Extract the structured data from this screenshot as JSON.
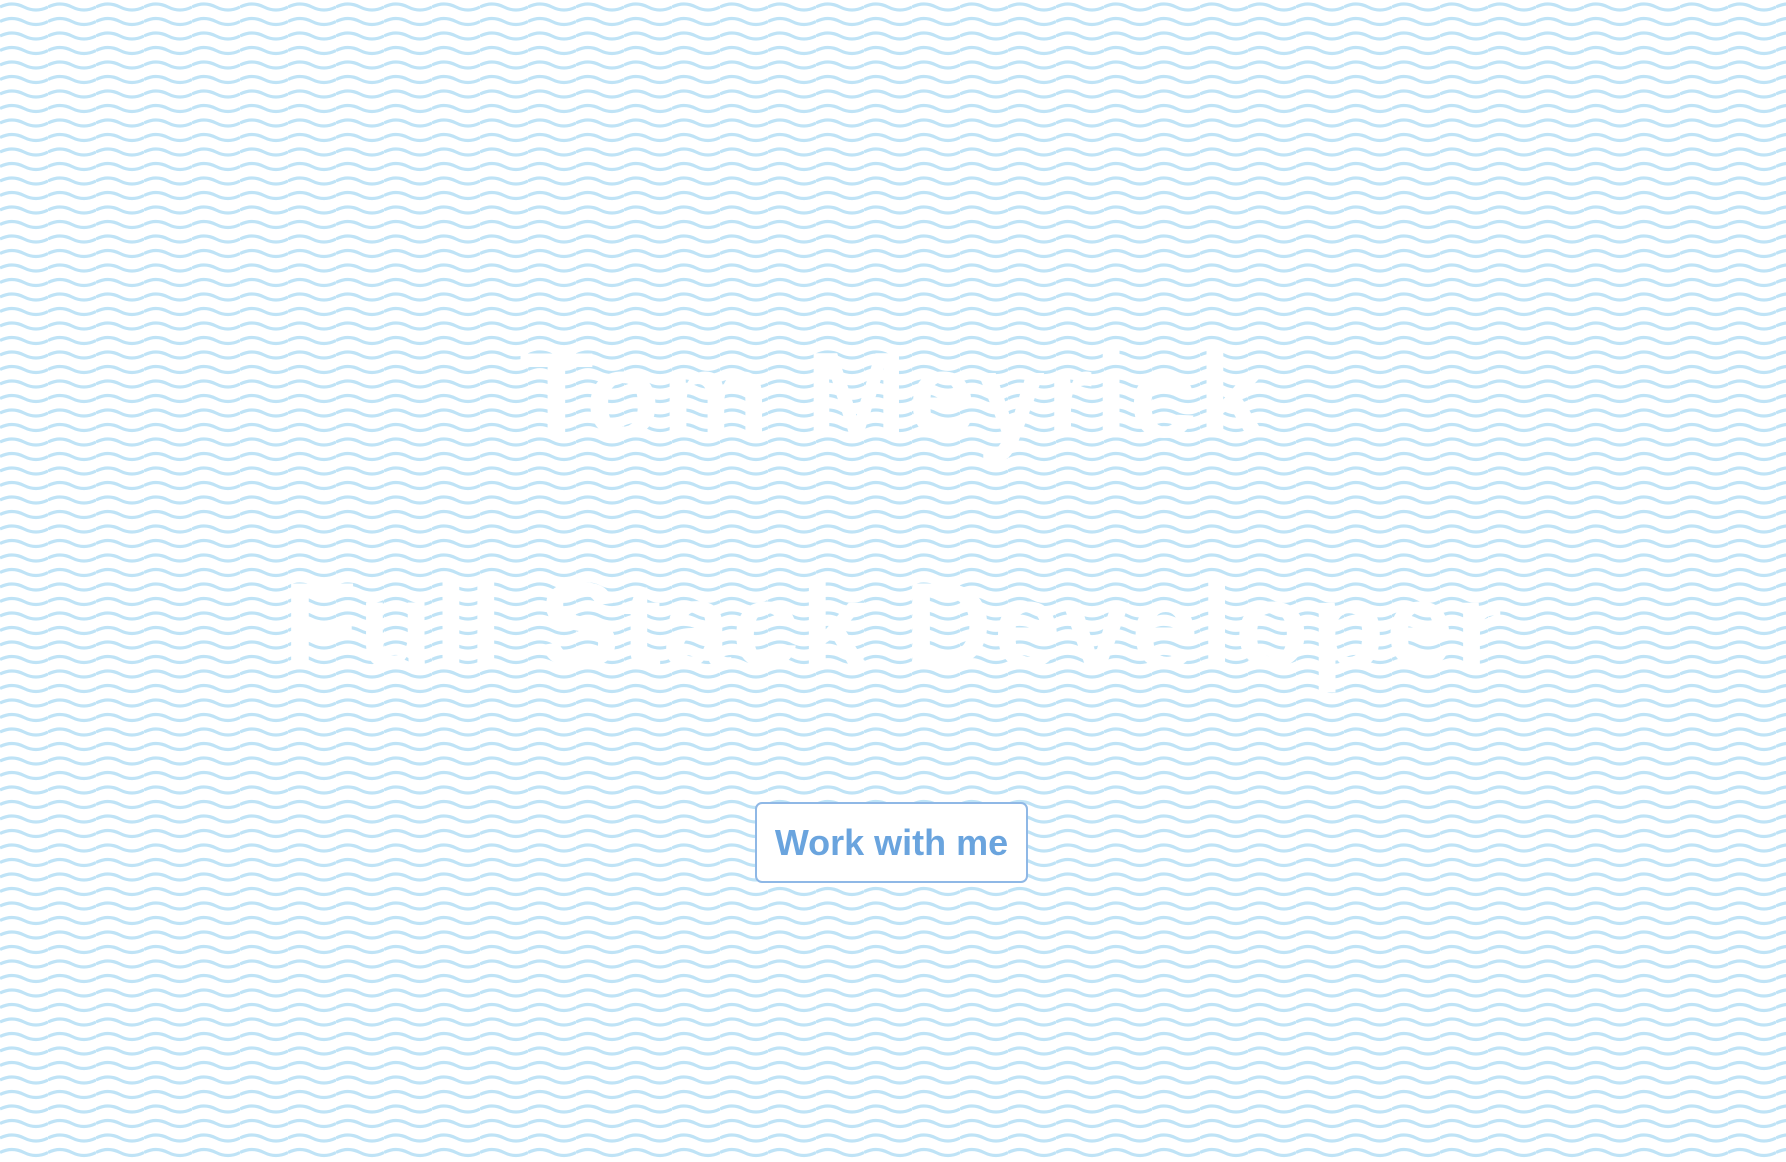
{
  "hero": {
    "name": "Tom Meyrick",
    "role": "Full Stack Developer",
    "cta_label": "Work with me"
  },
  "colors": {
    "background": "#ffffff",
    "wave_line": "#bfe3f6",
    "heading_text": "#ffffff",
    "button_text": "#6aa4de",
    "button_border": "#8fb8e6"
  },
  "background_pattern": "wavy-lines"
}
